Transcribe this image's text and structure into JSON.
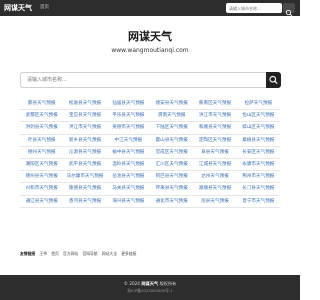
{
  "navbar": {
    "brand": "网谋天气",
    "home": "首页",
    "search_placeholder": "请输入城市名称..."
  },
  "hero": {
    "title": "网谋天气",
    "url": "www.wangmoutianqi.com"
  },
  "main_search": {
    "placeholder": "请输入城市名称..."
  },
  "cities": [
    [
      "鄞县天气预报",
      "松滋县天气预报",
      "仙居县天气预报",
      "绩安县天气预报",
      "蕉南区天气预报",
      "拉萨天气预报"
    ],
    [
      "武都区天气预报",
      "宝应县天气预报",
      "平乐县天气预报",
      "渭南天气预报",
      "洪江市天气预报",
      "恒山区天气预报"
    ],
    [
      "洪洞县天气预报",
      "洪江市天气预报",
      "英德市天气预报",
      "下陆区天气预报",
      "和顺县天气预报",
      "蚌山区天气预报"
    ],
    [
      "叶县天气预报",
      "新乡县天气预报",
      "中江天气预报",
      "霍山县天气预报",
      "定陶区天气预报",
      "桑植县天气预报"
    ],
    [
      "德州天气预报",
      "沁源县天气预报",
      "榆中县天气预报",
      "堂成区天气预报",
      "阜县天气预报",
      "长安区天气预报"
    ],
    [
      "潮阳区天气预报",
      "武平县天气预报",
      "温岭县天气预报",
      "汇川区天气预报",
      "江城县天气预报",
      "永康市天气预报"
    ],
    [
      "德州县天气预报",
      "马尔康市天气预报",
      "岳池县天气预报",
      "阿巴县天气预报",
      "达州天气预报",
      "荆州市天气预报"
    ],
    [
      "兴和市天气预报",
      "隆德县天气预报",
      "马关县天气预报",
      "怀来县天气预报",
      "富顺县天气预报",
      "长汀县天气预报"
    ],
    [
      "通辽县天气预报",
      "香河县天气预报",
      "海兴县天气预报",
      "通化市天气预报",
      "房县天气预报",
      "晋宁市天气预报"
    ]
  ],
  "links": {
    "label": "友情链接",
    "items": [
      "王爷",
      "首页",
      "官方网站",
      "官网导航",
      "网站大全",
      "更多链接"
    ]
  },
  "footer": {
    "prefix": "© 2024",
    "brand": "网谋天气",
    "suffix": "版权所有",
    "icp": "浙ICP备2023000000号-1"
  },
  "colors": {
    "navbar_bg": "#2d2d2d",
    "link_blue": "#3b6fb3",
    "button_dark": "#222222"
  }
}
